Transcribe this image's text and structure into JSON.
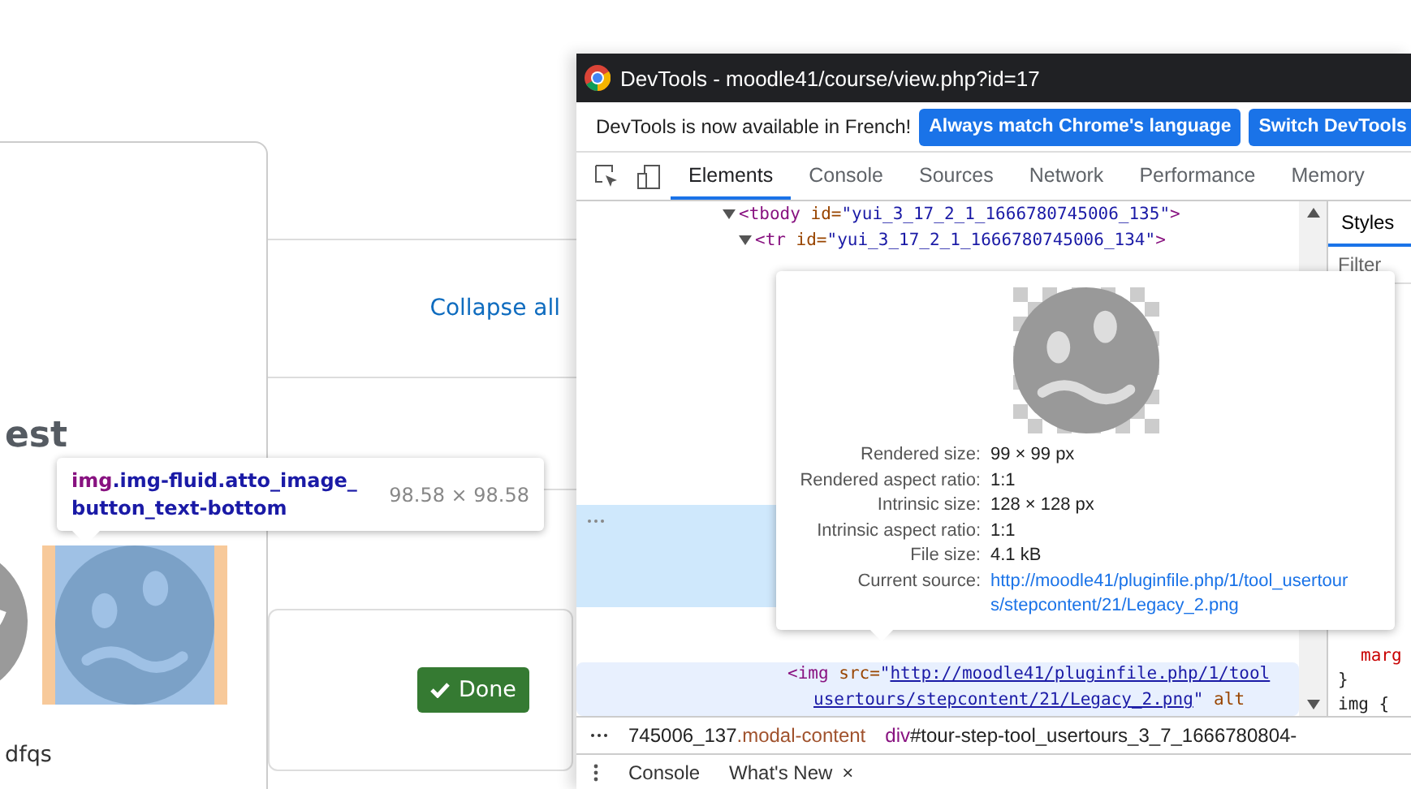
{
  "page": {
    "heading": "est",
    "caption": "dfqs",
    "collapse_link": "Collapse all",
    "done_button": "Done",
    "element_tooltip": {
      "tag": "img",
      "classes": ".img-fluid.atto_image_button_text-bottom",
      "size": "98.58 × 98.58"
    }
  },
  "window": {
    "title": "DevTools - moodle41/course/view.php?id=17"
  },
  "infobar": {
    "message": "DevTools is now available in French!",
    "buttons": [
      "Always match Chrome's language",
      "Switch DevTools"
    ]
  },
  "tabs": [
    {
      "label": "Elements",
      "selected": true
    },
    {
      "label": "Console",
      "selected": false
    },
    {
      "label": "Sources",
      "selected": false
    },
    {
      "label": "Network",
      "selected": false
    },
    {
      "label": "Performance",
      "selected": false
    },
    {
      "label": "Memory",
      "selected": false
    }
  ],
  "dom_lines": [
    {
      "expanded": true,
      "tokens": [
        {
          "kind": "tag",
          "text": "<tbody"
        },
        {
          "kind": "attr",
          "text": " id="
        },
        {
          "kind": "value",
          "text": "\"yui_3_17_2_1_1666780745006_135\""
        },
        {
          "kind": "tag",
          "text": ">"
        }
      ],
      "children": [
        {
          "expanded": true,
          "tokens": [
            {
              "kind": "tag",
              "text": "<tr"
            },
            {
              "kind": "attr",
              "text": " id="
            },
            {
              "kind": "value",
              "text": "\"yui_3_17_2_1_1666780745006_134\""
            },
            {
              "kind": "tag",
              "text": ">"
            }
          ]
        }
      ]
    }
  ],
  "img_lines": [
    [
      {
        "kind": "tag",
        "text": "<img"
      },
      {
        "kind": "attr",
        "text": " src="
      },
      {
        "kind": "value",
        "text": "\""
      },
      {
        "kind": "link",
        "text": "http://moodle41/pluginfile.php/1/tool"
      }
    ],
    [
      {
        "kind": "link",
        "text": "usertours/stepcontent/21/Legacy_2.png"
      },
      {
        "kind": "value",
        "text": "\""
      },
      {
        "kind": "attr",
        "text": " alt"
      }
    ]
  ],
  "breadcrumbs": [
    [
      {
        "kind": "plain",
        "text": "745006_137"
      },
      {
        "kind": "cls",
        "text": ".modal-content"
      }
    ],
    [
      {
        "kind": "tag",
        "text": "div"
      },
      {
        "kind": "plain",
        "text": "#tour-step-tool_usertours_3_7_1666780804-"
      }
    ]
  ],
  "styles": {
    "tab": "Styles",
    "filter": "Filter",
    "lines": [
      "marg",
      "}",
      "img {"
    ]
  },
  "image_preview": {
    "rows": [
      {
        "label": "Rendered size:",
        "value": "99 × 99 px"
      },
      {
        "label": "Rendered aspect ratio:",
        "value": "1:1"
      },
      {
        "label": "Intrinsic size:",
        "value": "128 × 128 px"
      },
      {
        "label": "Intrinsic aspect ratio:",
        "value": "1:1"
      },
      {
        "label": "File size:",
        "value": "4.1 kB"
      }
    ],
    "source_label": "Current source:",
    "source_url": "http://moodle41/pluginfile.php/1/tool_usertours/stepcontent/21/Legacy_2.png"
  },
  "drawer": {
    "tabs": [
      {
        "label": "Console",
        "closable": false
      },
      {
        "label": "What's New",
        "closable": true
      }
    ],
    "close": "×"
  }
}
